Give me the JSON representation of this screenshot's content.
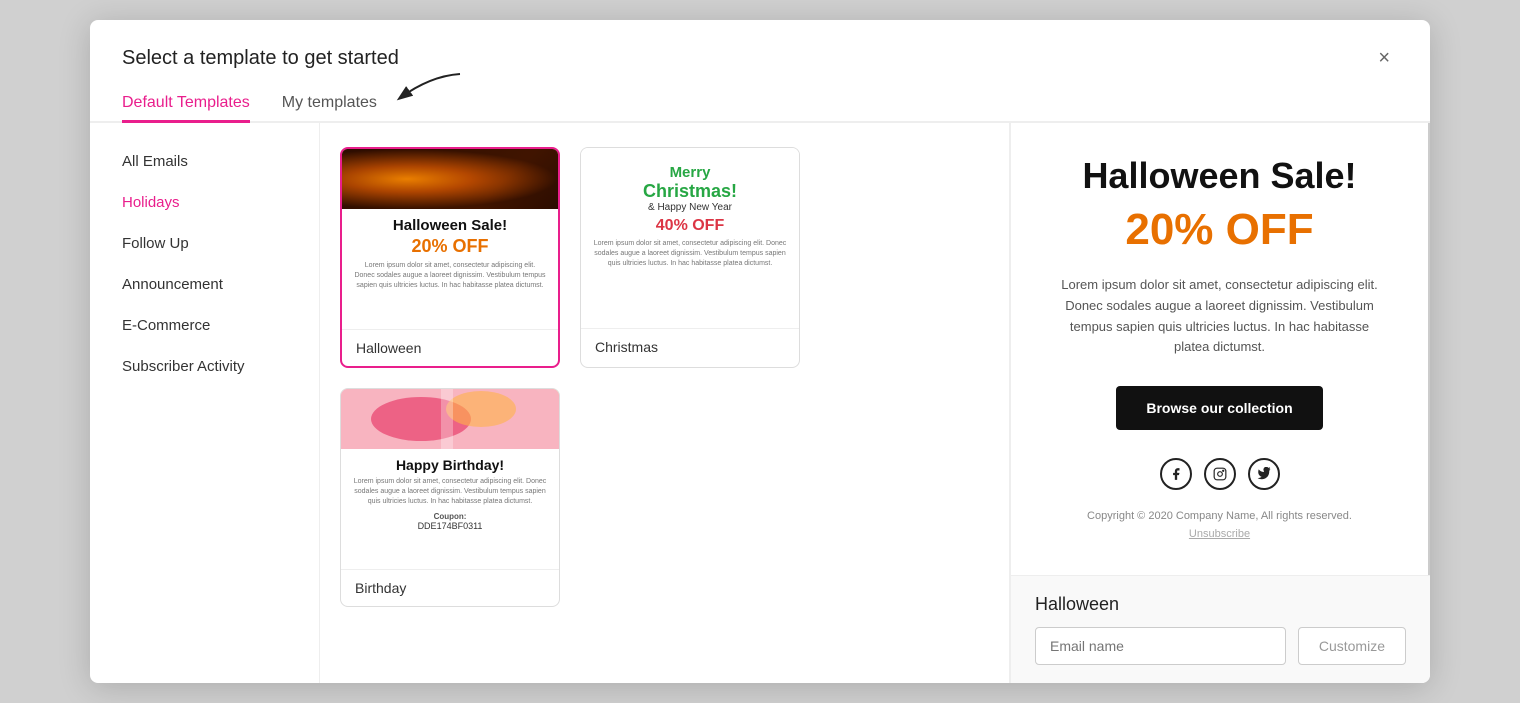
{
  "modal": {
    "title": "Select a template to get started",
    "close_label": "×"
  },
  "tabs": [
    {
      "id": "default",
      "label": "Default Templates",
      "active": true
    },
    {
      "id": "my",
      "label": "My templates",
      "active": false
    }
  ],
  "sidebar": {
    "items": [
      {
        "id": "all",
        "label": "All Emails",
        "active": false
      },
      {
        "id": "holidays",
        "label": "Holidays",
        "active": true
      },
      {
        "id": "follow-up",
        "label": "Follow Up",
        "active": false
      },
      {
        "id": "announcement",
        "label": "Announcement",
        "active": false
      },
      {
        "id": "ecommerce",
        "label": "E-Commerce",
        "active": false
      },
      {
        "id": "subscriber",
        "label": "Subscriber Activity",
        "active": false
      }
    ]
  },
  "templates": [
    {
      "id": "halloween",
      "type": "halloween",
      "heading": "Halloween Sale!",
      "discount": "20% OFF",
      "lorem": "Lorem ipsum dolor sit amet, consectetur adipiscing elit. Donec sodales augue a laoreet dignissim. Vestibulum tempus sapien quis ultricies luctus. In hac habitasse platea dictumst.",
      "label": "Halloween",
      "selected": true
    },
    {
      "id": "christmas",
      "type": "christmas",
      "pre_heading": "Merry",
      "heading": "Christmas!",
      "sub_heading": "& Happy New Year",
      "discount": "40% OFF",
      "lorem": "Lorem ipsum dolor sit amet, consectetur adipiscing elit. Donec sodales augue a laoreet dignissim. Vestibulum tempus sapien quis ultricies luctus. In hac habitasse platea dictumst.",
      "label": "Christmas",
      "selected": false
    },
    {
      "id": "birthday",
      "type": "birthday",
      "heading": "Happy Birthday!",
      "lorem": "Lorem ipsum dolor sit amet, consectetur adipiscing elit. Donec sodales augue a laoreet dignissim. Vestibulum tempus sapien quis ultricies luctus. In hac habitasse platea dictumst.",
      "coupon_label": "Coupon:",
      "coupon_code": "DDE174BF0311",
      "label": "Birthday",
      "selected": false
    }
  ],
  "preview": {
    "title": "Halloween Sale!",
    "discount": "20% OFF",
    "lorem": "Lorem ipsum dolor sit amet, consectetur adipiscing elit. Donec sodales augue a laoreet dignissim. Vestibulum tempus sapien quis ultricies luctus. In hac habitasse platea dictumst.",
    "btn_label": "Browse our collection",
    "footer_text": "Copyright © 2020 Company Name, All rights reserved.",
    "unsubscribe": "Unsubscribe",
    "name_label": "Halloween",
    "email_placeholder": "Email name",
    "customize_label": "Customize"
  },
  "colors": {
    "accent_pink": "#e91e8c",
    "accent_orange": "#e87000",
    "dark": "#111111"
  }
}
